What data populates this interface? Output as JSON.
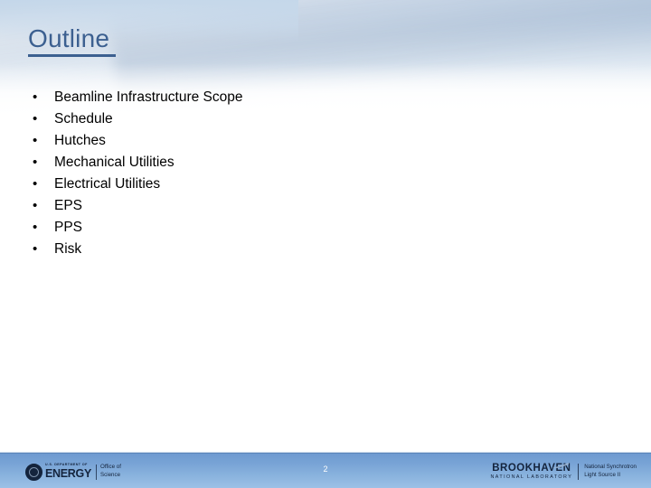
{
  "slide": {
    "title": "Outline",
    "page_number": "2",
    "accent_color": "#3c6090",
    "footer_color": "#6e9ad0",
    "body_text_color": "#000000"
  },
  "outline": {
    "bullet_glyph": "•",
    "items": [
      {
        "label": "Beamline Infrastructure Scope"
      },
      {
        "label": "Schedule"
      },
      {
        "label": "Hutches"
      },
      {
        "label": "Mechanical Utilities"
      },
      {
        "label": "Electrical Utilities"
      },
      {
        "label": "EPS"
      },
      {
        "label": "PPS"
      },
      {
        "label": "Risk"
      }
    ]
  },
  "footer": {
    "doe_logo": {
      "department_line": "U.S. DEPARTMENT OF",
      "agency": "ENERGY",
      "office_line1": "Office of",
      "office_line2": "Science"
    },
    "bnl_logo": {
      "lab_name": "BROOKHAVEN",
      "lab_subtitle": "NATIONAL LABORATORY",
      "facility_line1": "National Synchrotron",
      "facility_line2": "Light Source II"
    }
  }
}
